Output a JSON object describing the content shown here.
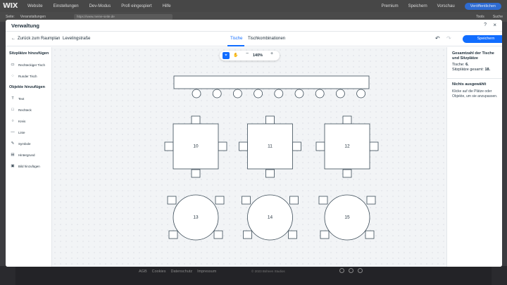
{
  "editor": {
    "logo": "WIX",
    "menu": [
      "Website",
      "Einstellungen",
      "Dev-Modus",
      "Profi eingespiert",
      "Hilfe"
    ],
    "right_items": [
      "Premium",
      "Speichern",
      "Vorschau"
    ],
    "publish_label": "Veröffentlichen",
    "bar2_items": [
      "Seite:",
      "Veranstaltungen"
    ],
    "url_text": "https://www.meine-seite.de",
    "bar2_right": [
      "Tools",
      "Suche"
    ]
  },
  "modal": {
    "title": "Verwaltung",
    "help": "?",
    "close": "×",
    "back_label": "Zurück zum Raumplan",
    "plan_name": "Levelingstraße",
    "tabs": [
      "Tische",
      "Tischkombinationen"
    ],
    "save_label": "Speichern",
    "undo": "↶",
    "redo": "↷"
  },
  "left_panel": {
    "seats_heading": "Sitzplätze hinzufügen",
    "seat_items": [
      {
        "label": "Rechteckiger Tisch",
        "icon": "rect-table-icon"
      },
      {
        "label": "Runder Tisch",
        "icon": "round-table-icon"
      }
    ],
    "objects_heading": "Objekte hinzufügen",
    "object_items": [
      {
        "label": "Text",
        "icon": "text-icon"
      },
      {
        "label": "Rechteck",
        "icon": "rectangle-icon"
      },
      {
        "label": "Kreis",
        "icon": "circle-icon"
      },
      {
        "label": "Linie",
        "icon": "line-icon"
      },
      {
        "label": "Symbole",
        "icon": "symbols-icon"
      },
      {
        "label": "Hintergrund",
        "icon": "background-icon"
      },
      {
        "label": "Bild hinzufügen",
        "icon": "image-icon"
      }
    ]
  },
  "canvas": {
    "zoom": "140%",
    "zoom_out": "−",
    "zoom_in": "+",
    "tables": [
      {
        "id": "10",
        "shape": "square"
      },
      {
        "id": "11",
        "shape": "square"
      },
      {
        "id": "12",
        "shape": "square"
      },
      {
        "id": "13",
        "shape": "round"
      },
      {
        "id": "14",
        "shape": "round"
      },
      {
        "id": "15",
        "shape": "round"
      }
    ]
  },
  "right_panel": {
    "stats_title": "Gesamtzahl der Tische und Sitzplätze",
    "tables_label": "Tische:",
    "tables_value": "6.",
    "seats_label": "Sitzplätze gesamt:",
    "seats_value": "18.",
    "nothing_title": "Nichts ausgewählt",
    "nothing_desc": "Klicke auf die Plätze oder Objekte, um sie anzupassen."
  },
  "footer": {
    "links": [
      "AGB",
      "Cookies",
      "Datenschutz",
      "Impressum"
    ],
    "copyright": "© 2023 Bühnen Studios"
  }
}
